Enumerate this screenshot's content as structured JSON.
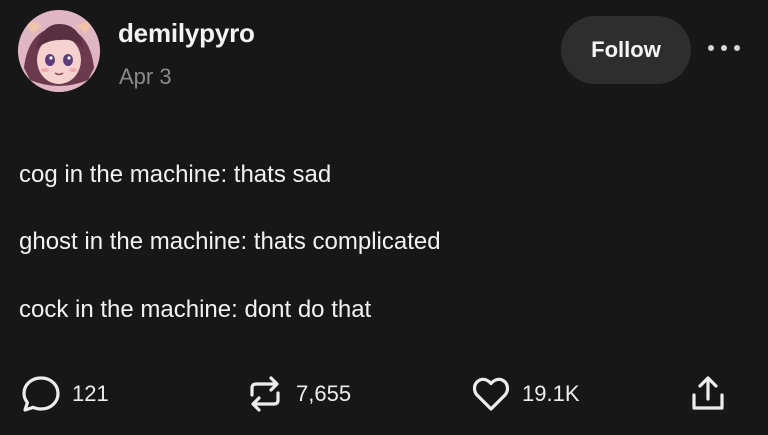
{
  "post": {
    "author": {
      "username": "demilypyro",
      "date": "Apr 3",
      "avatar_icon": "anime-avatar"
    },
    "follow_label": "Follow",
    "more_icon": "ellipsis-icon",
    "lines": [
      "cog in the machine: thats sad",
      "ghost in the machine: thats complicated",
      "cock in the machine: dont do that"
    ],
    "actions": {
      "replies": "121",
      "reblogs": "7,655",
      "likes": "19.1K"
    }
  },
  "colors": {
    "background": "#171717",
    "text": "#f2f2f2",
    "muted": "#8a8a8a",
    "button_bg": "#2e2e2e"
  }
}
